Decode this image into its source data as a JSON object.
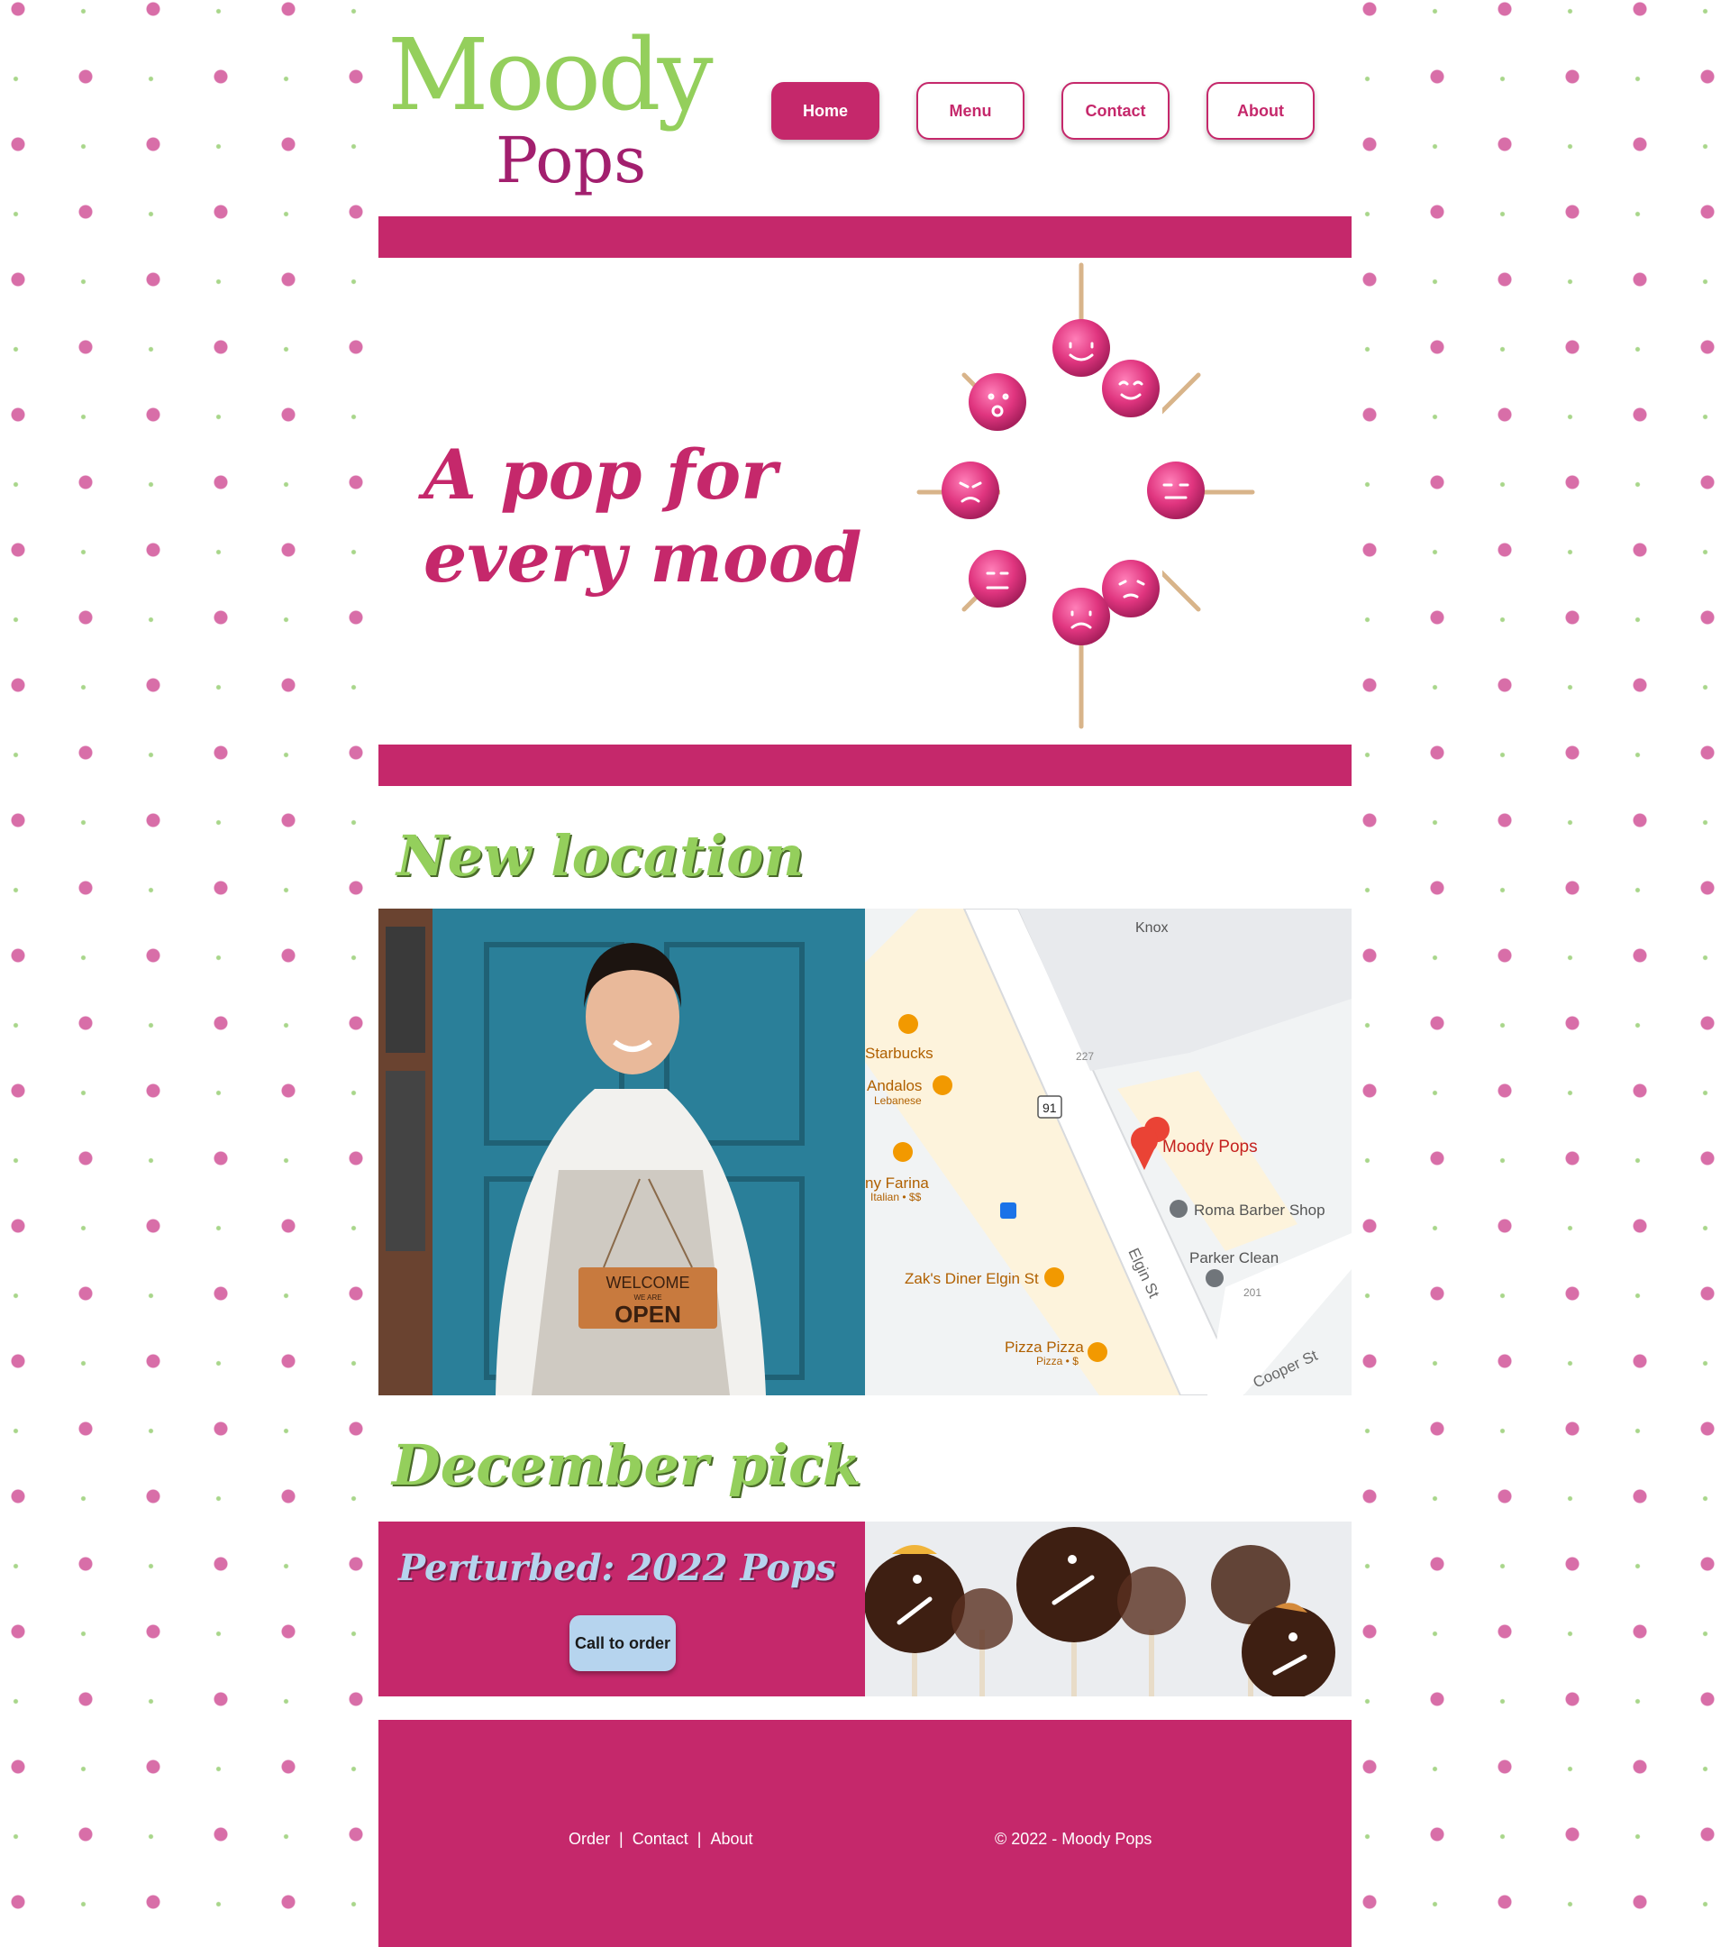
{
  "brand": {
    "logo_top": "Moody",
    "logo_bottom": "Pops",
    "primary_color": "#c5286b",
    "accent_green": "#94cf5c",
    "accent_blue": "#b6d4ee"
  },
  "nav": {
    "items": [
      {
        "label": "Home",
        "active": true
      },
      {
        "label": "Menu",
        "active": false
      },
      {
        "label": "Contact",
        "active": false
      },
      {
        "label": "About",
        "active": false
      }
    ]
  },
  "hero": {
    "tagline_line1": "A pop for",
    "tagline_line2": "every mood"
  },
  "location": {
    "title": "New location",
    "photo_sign_top": "WELCOME",
    "photo_sign_mid": "WE ARE",
    "photo_sign_bottom": "OPEN",
    "map": {
      "labels": [
        {
          "text": "Knox"
        },
        {
          "text": "Starbucks"
        },
        {
          "text": "Andalos"
        },
        {
          "text": "Lebanese"
        },
        {
          "text": "ny Farina"
        },
        {
          "text": "Italian • $$"
        },
        {
          "text": "Zak's Diner Elgin St"
        },
        {
          "text": "Pizza Pizza"
        },
        {
          "text": "Pizza • $"
        },
        {
          "text": "Moody Pops"
        },
        {
          "text": "Roma Barber Shop"
        },
        {
          "text": "Parker Clean"
        },
        {
          "text": "Elgin St"
        },
        {
          "text": "Cooper St"
        },
        {
          "text": "227"
        },
        {
          "text": "201"
        },
        {
          "text": "91"
        }
      ]
    }
  },
  "december": {
    "title": "December pick",
    "product_name": "Perturbed: 2022 Pops",
    "cta_label": "Call to order"
  },
  "footer": {
    "links": [
      "Order",
      "Contact",
      "About"
    ],
    "separator": "|",
    "copyright": "© 2022 - Moody Pops"
  }
}
